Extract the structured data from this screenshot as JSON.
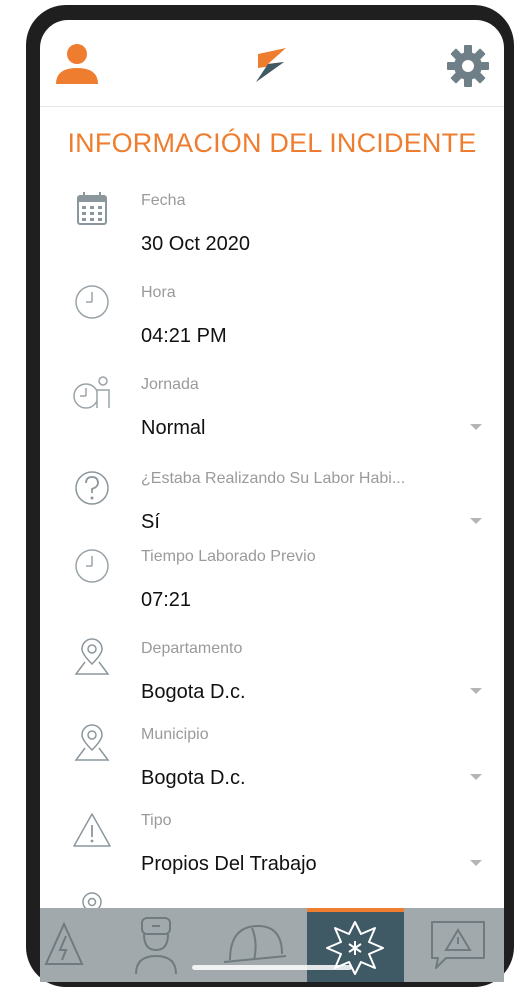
{
  "app": {
    "title": "INFORMACIÓN DEL INCIDENTE",
    "accent_color": "#ee7d2f",
    "tabbar_color": "#a2a9ac",
    "active_tab_color": "#3f5965"
  },
  "header": {
    "profile_icon": "person-icon",
    "logo": "brand-logo",
    "settings_icon": "gear-icon"
  },
  "fields": [
    {
      "icon": "calendar-icon",
      "label": "Fecha",
      "value": "30 Oct 2020",
      "dropdown": false
    },
    {
      "icon": "clock-icon",
      "label": "Hora",
      "value": "04:21 PM",
      "dropdown": false
    },
    {
      "icon": "worker-clock-icon",
      "label": "Jornada",
      "value": "Normal",
      "dropdown": true
    },
    {
      "icon": "question-icon",
      "label": "¿Estaba Realizando Su Labor Habi...",
      "value": "Sí",
      "dropdown": true
    },
    {
      "icon": "clock-icon",
      "label": "Tiempo Laborado Previo",
      "value": "07:21",
      "dropdown": false
    },
    {
      "icon": "map-pin-icon",
      "label": "Departamento",
      "value": "Bogota D.c.",
      "dropdown": true
    },
    {
      "icon": "map-pin-icon",
      "label": "Municipio",
      "value": "Bogota D.c.",
      "dropdown": true
    },
    {
      "icon": "warning-icon",
      "label": "Tipo",
      "value": "Propios Del Trabajo",
      "dropdown": true
    }
  ],
  "tabs": [
    {
      "icon": "electric-hazard-icon",
      "active": false
    },
    {
      "icon": "medic-icon",
      "active": false
    },
    {
      "icon": "helmet-icon",
      "active": false
    },
    {
      "icon": "explosion-icon",
      "active": true
    },
    {
      "icon": "alert-chat-icon",
      "active": false
    }
  ]
}
